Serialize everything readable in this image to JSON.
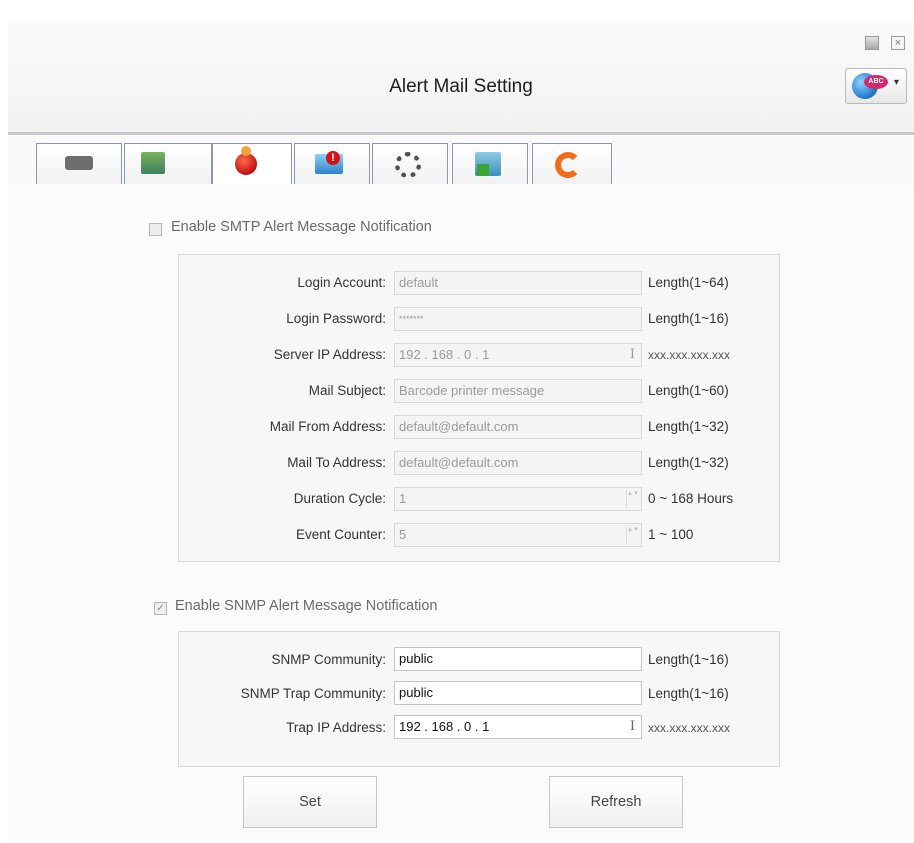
{
  "window": {
    "title": "Alert Mail Setting",
    "close_glyph": "×"
  },
  "icons": {
    "minimize": "minimize-icon",
    "close": "close-icon",
    "language": "language-globe-icon",
    "language_badge": "ABC",
    "caret": "▾",
    "ibeam": "I",
    "spin": "▲▼"
  },
  "tabs": [
    {
      "name": "printer",
      "icon": "printer-icon"
    },
    {
      "name": "network",
      "icon": "network-icon"
    },
    {
      "name": "alert",
      "icon": "alert-icon",
      "active": true
    },
    {
      "name": "mail",
      "icon": "mail-alert-icon"
    },
    {
      "name": "config",
      "icon": "gears-icon"
    },
    {
      "name": "ops",
      "icon": "file-operations-icon"
    },
    {
      "name": "update",
      "icon": "refresh-update-icon"
    }
  ],
  "smtp": {
    "enable_label": "Enable SMTP Alert Message Notification",
    "enabled": false,
    "fields": {
      "login_account": {
        "label": "Login Account:",
        "value": "default",
        "hint": "Length(1~64)"
      },
      "login_password": {
        "label": "Login Password:",
        "value": "*******",
        "hint": "Length(1~16)"
      },
      "server_ip": {
        "label": "Server IP Address:",
        "value": "192 . 168 . 0 . 1",
        "hint": "xxx.xxx.xxx.xxx"
      },
      "mail_subject": {
        "label": "Mail Subject:",
        "value": "Barcode printer message",
        "hint": "Length(1~60)"
      },
      "mail_from": {
        "label": "Mail From Address:",
        "value": "default@default.com",
        "hint": "Length(1~32)"
      },
      "mail_to": {
        "label": "Mail To Address:",
        "value": "default@default.com",
        "hint": "Length(1~32)"
      },
      "duration_cycle": {
        "label": "Duration Cycle:",
        "value": "1",
        "hint": "0 ~ 168 Hours"
      },
      "event_counter": {
        "label": "Event Counter:",
        "value": "5",
        "hint": "1 ~ 100"
      }
    }
  },
  "snmp": {
    "enable_label": "Enable SNMP Alert Message Notification",
    "enabled": true,
    "check_glyph": "✓",
    "fields": {
      "community": {
        "label": "SNMP Community:",
        "value": "public",
        "hint": "Length(1~16)"
      },
      "trap_community": {
        "label": "SNMP Trap Community:",
        "value": "public",
        "hint": "Length(1~16)"
      },
      "trap_ip": {
        "label": "Trap IP Address:",
        "value": "192 . 168 . 0 . 1",
        "hint": "xxx.xxx.xxx.xxx"
      }
    }
  },
  "buttons": {
    "set": "Set",
    "refresh": "Refresh"
  },
  "colors": {
    "tab_border": "#8a96b7",
    "tab_underline": "#f3e79a",
    "text_disabled": "#9a9a9a"
  }
}
